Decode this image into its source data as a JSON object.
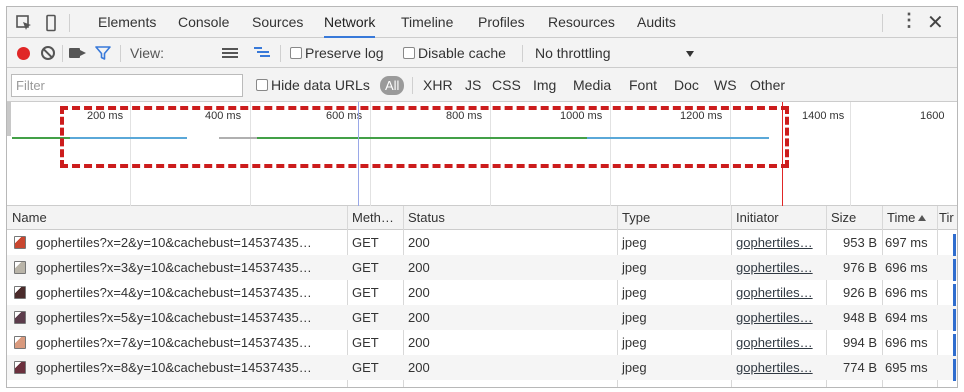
{
  "tabs": {
    "items": [
      "Elements",
      "Console",
      "Sources",
      "Network",
      "Timeline",
      "Profiles",
      "Resources",
      "Audits"
    ],
    "active": "Network",
    "menu_icon": "vertical-ellipsis-icon",
    "close_icon": "close-icon"
  },
  "toolbar": {
    "view_label": "View:",
    "preserve_log_label": "Preserve log",
    "disable_cache_label": "Disable cache",
    "throttling_value": "No throttling",
    "record_color": "#e02626",
    "filter_icon_color": "#3879d9"
  },
  "filterbar": {
    "placeholder": "Filter",
    "hide_data_urls_label": "Hide data URLs",
    "all_label": "All",
    "types": [
      "XHR",
      "JS",
      "CSS",
      "Img",
      "Media",
      "Font",
      "Doc",
      "WS",
      "Other"
    ]
  },
  "overview": {
    "ticks": [
      "200 ms",
      "400 ms",
      "600 ms",
      "800 ms",
      "1000 ms",
      "1200 ms",
      "1400 ms",
      "1600"
    ],
    "dom_content_loaded_color": "#3879d9",
    "load_color": "#e02626",
    "annotation_color": "#cc1c1c"
  },
  "table": {
    "headers": {
      "name": "Name",
      "method": "Meth…",
      "status": "Status",
      "type": "Type",
      "initiator": "Initiator",
      "size": "Size",
      "time": "Time",
      "timeline": "Tir"
    },
    "rows": [
      {
        "name": "gophertiles?x=2&y=10&cachebust=14537435…",
        "method": "GET",
        "status": "200",
        "type": "jpeg",
        "initiator": "gophertiles…",
        "size": "953 B",
        "time": "697 ms",
        "thumb": "#c9462f"
      },
      {
        "name": "gophertiles?x=3&y=10&cachebust=14537435…",
        "method": "GET",
        "status": "200",
        "type": "jpeg",
        "initiator": "gophertiles…",
        "size": "976 B",
        "time": "696 ms",
        "thumb": "#b9b4a8"
      },
      {
        "name": "gophertiles?x=4&y=10&cachebust=14537435…",
        "method": "GET",
        "status": "200",
        "type": "jpeg",
        "initiator": "gophertiles…",
        "size": "926 B",
        "time": "696 ms",
        "thumb": "#4a2b2b"
      },
      {
        "name": "gophertiles?x=5&y=10&cachebust=14537435…",
        "method": "GET",
        "status": "200",
        "type": "jpeg",
        "initiator": "gophertiles…",
        "size": "948 B",
        "time": "694 ms",
        "thumb": "#5b3b4a"
      },
      {
        "name": "gophertiles?x=7&y=10&cachebust=14537435…",
        "method": "GET",
        "status": "200",
        "type": "jpeg",
        "initiator": "gophertiles…",
        "size": "994 B",
        "time": "696 ms",
        "thumb": "#d99a7e"
      },
      {
        "name": "gophertiles?x=8&y=10&cachebust=14537435…",
        "method": "GET",
        "status": "200",
        "type": "jpeg",
        "initiator": "gophertiles…",
        "size": "774 B",
        "time": "695 ms",
        "thumb": "#6a2f3c"
      }
    ]
  }
}
